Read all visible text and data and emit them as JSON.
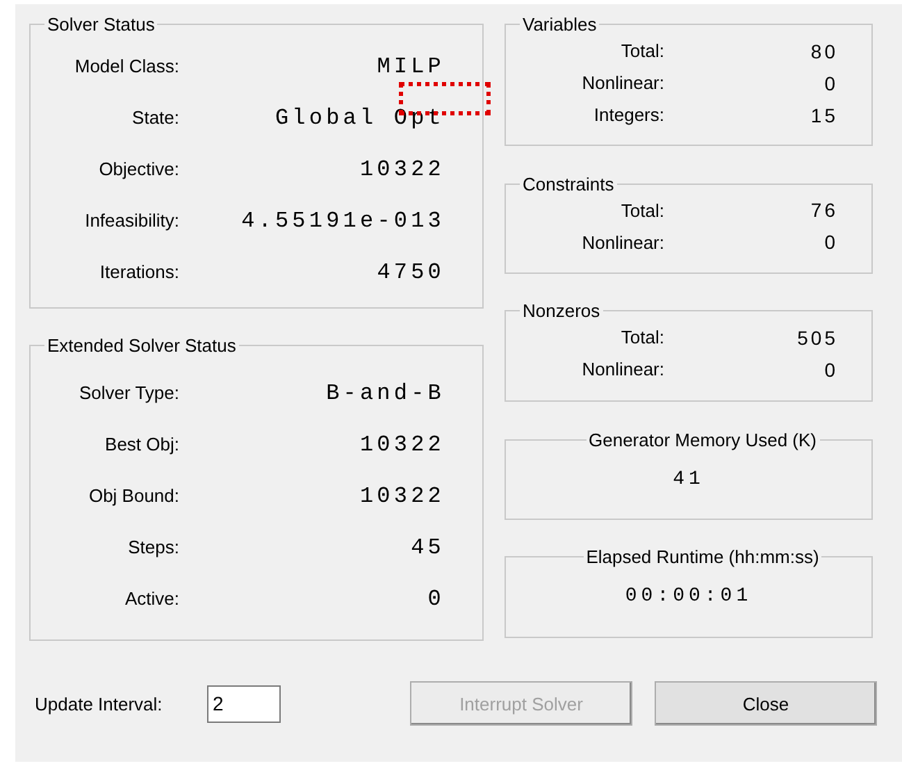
{
  "solver_status": {
    "title": "Solver Status",
    "rows": [
      {
        "label": "Model Class:",
        "value": "MILP",
        "highlighted": false
      },
      {
        "label": "State:",
        "value": "Global Opt",
        "highlighted": true
      },
      {
        "label": "Objective:",
        "value": "10322",
        "highlighted": false
      },
      {
        "label": "Infeasibility:",
        "value": "4.55191e-013",
        "highlighted": false
      },
      {
        "label": "Iterations:",
        "value": "4750",
        "highlighted": false
      }
    ]
  },
  "extended_solver_status": {
    "title": "Extended Solver Status",
    "rows": [
      {
        "label": "Solver Type:",
        "value": "B-and-B"
      },
      {
        "label": "Best Obj:",
        "value": "10322"
      },
      {
        "label": "Obj Bound:",
        "value": "10322"
      },
      {
        "label": "Steps:",
        "value": "45"
      },
      {
        "label": "Active:",
        "value": "0"
      }
    ]
  },
  "variables": {
    "title": "Variables",
    "rows": [
      {
        "label": "Total:",
        "value": "80"
      },
      {
        "label": "Nonlinear:",
        "value": "0"
      },
      {
        "label": "Integers:",
        "value": "15"
      }
    ]
  },
  "constraints": {
    "title": "Constraints",
    "rows": [
      {
        "label": "Total:",
        "value": "76"
      },
      {
        "label": "Nonlinear:",
        "value": "0"
      }
    ]
  },
  "nonzeros": {
    "title": "Nonzeros",
    "rows": [
      {
        "label": "Total:",
        "value": "505"
      },
      {
        "label": "Nonlinear:",
        "value": "0"
      }
    ]
  },
  "generator_memory": {
    "title": "Generator Memory Used (K)",
    "value": "41"
  },
  "elapsed_runtime": {
    "title": "Elapsed Runtime (hh:mm:ss)",
    "value": "00:00:01"
  },
  "update_interval": {
    "label": "Update Interval:",
    "value": "2"
  },
  "buttons": [
    {
      "label": "Interrupt Solver",
      "disabled": true
    },
    {
      "label": "Close",
      "disabled": false
    }
  ]
}
